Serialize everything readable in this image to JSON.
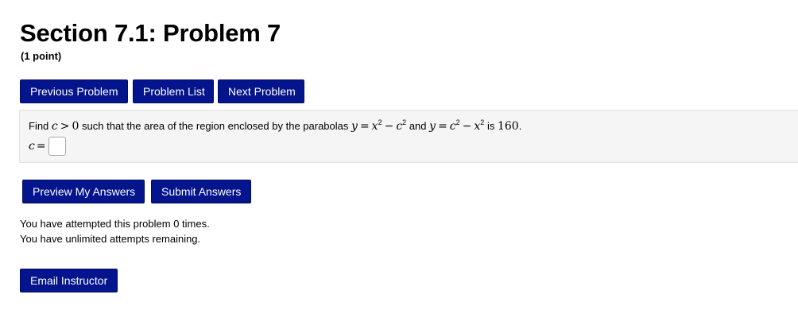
{
  "header": {
    "title": "Section 7.1: Problem 7",
    "points": "(1 point)"
  },
  "nav": {
    "previous_label": "Previous Problem",
    "list_label": "Problem List",
    "next_label": "Next Problem"
  },
  "problem": {
    "text_find": "Find",
    "c": "c",
    "gt": ">",
    "zero": "0",
    "text_mid": "such that the area of the region enclosed by the parabolas",
    "y1": "y",
    "eq1": "=",
    "x1": "x",
    "exp1": "2",
    "minus1": "−",
    "c1": "c",
    "exp2": "2",
    "text_and": "and",
    "y2": "y",
    "eq2": "=",
    "c2": "c",
    "exp3": "2",
    "minus2": "−",
    "x2": "x",
    "exp4": "2",
    "text_is": "is",
    "value": "160",
    "period": "."
  },
  "answer": {
    "label_var": "c",
    "label_eq": "=",
    "value": ""
  },
  "actions": {
    "preview_label": "Preview My Answers",
    "submit_label": "Submit Answers"
  },
  "status": {
    "attempted": "You have attempted this problem 0 times.",
    "remaining": "You have unlimited attempts remaining."
  },
  "footer": {
    "email_label": "Email Instructor"
  },
  "colors": {
    "button_bg": "#04148c",
    "problem_bg": "#f5f5f5"
  }
}
